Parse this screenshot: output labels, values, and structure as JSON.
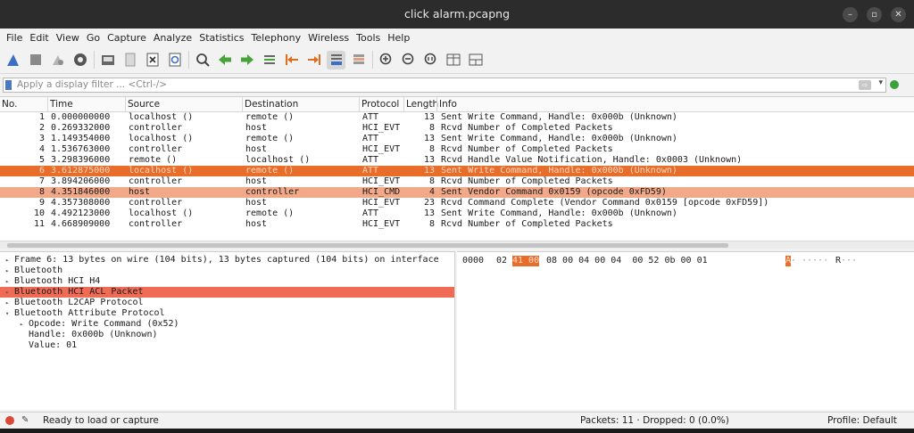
{
  "window": {
    "title": "click alarm.pcapng"
  },
  "menu": [
    "File",
    "Edit",
    "View",
    "Go",
    "Capture",
    "Analyze",
    "Statistics",
    "Telephony",
    "Wireless",
    "Tools",
    "Help"
  ],
  "filter": {
    "placeholder": "Apply a display filter ... <Ctrl-/>"
  },
  "columns": {
    "no": "No.",
    "time": "Time",
    "source": "Source",
    "destination": "Destination",
    "protocol": "Protocol",
    "length": "Length",
    "info": "Info"
  },
  "packets": [
    {
      "no": "1",
      "time": "0.000000000",
      "source": "localhost ()",
      "destination": "remote ()",
      "protocol": "ATT",
      "length": "13",
      "info": "Sent Write Command, Handle: 0x000b (Unknown)"
    },
    {
      "no": "2",
      "time": "0.269332000",
      "source": "controller",
      "destination": "host",
      "protocol": "HCI_EVT",
      "length": "8",
      "info": "Rcvd Number of Completed Packets"
    },
    {
      "no": "3",
      "time": "1.149354000",
      "source": "localhost ()",
      "destination": "remote ()",
      "protocol": "ATT",
      "length": "13",
      "info": "Sent Write Command, Handle: 0x000b (Unknown)"
    },
    {
      "no": "4",
      "time": "1.536763000",
      "source": "controller",
      "destination": "host",
      "protocol": "HCI_EVT",
      "length": "8",
      "info": "Rcvd Number of Completed Packets"
    },
    {
      "no": "5",
      "time": "3.298396000",
      "source": "remote ()",
      "destination": "localhost ()",
      "protocol": "ATT",
      "length": "13",
      "info": "Rcvd Handle Value Notification, Handle: 0x0003 (Unknown)"
    },
    {
      "no": "6",
      "time": "3.612875000",
      "source": "localhost ()",
      "destination": "remote ()",
      "protocol": "ATT",
      "length": "13",
      "info": "Sent Write Command, Handle: 0x000b (Unknown)"
    },
    {
      "no": "7",
      "time": "3.894206000",
      "source": "controller",
      "destination": "host",
      "protocol": "HCI_EVT",
      "length": "8",
      "info": "Rcvd Number of Completed Packets"
    },
    {
      "no": "8",
      "time": "4.351846000",
      "source": "host",
      "destination": "controller",
      "protocol": "HCI_CMD",
      "length": "4",
      "info": "Sent Vendor Command 0x0159 (opcode 0xFD59)"
    },
    {
      "no": "9",
      "time": "4.357308000",
      "source": "controller",
      "destination": "host",
      "protocol": "HCI_EVT",
      "length": "23",
      "info": "Rcvd Command Complete (Vendor Command 0x0159 [opcode 0xFD59])"
    },
    {
      "no": "10",
      "time": "4.492123000",
      "source": "localhost ()",
      "destination": "remote ()",
      "protocol": "ATT",
      "length": "13",
      "info": "Sent Write Command, Handle: 0x000b (Unknown)"
    },
    {
      "no": "11",
      "time": "4.668909000",
      "source": "controller",
      "destination": "host",
      "protocol": "HCI_EVT",
      "length": "8",
      "info": "Rcvd Number of Completed Packets"
    }
  ],
  "selected_packet": "6",
  "details": [
    {
      "text": "Frame 6: 13 bytes on wire (104 bits), 13 bytes captured (104 bits) on interface",
      "tri": "▸"
    },
    {
      "text": "Bluetooth",
      "tri": "▸"
    },
    {
      "text": "Bluetooth HCI H4",
      "tri": "▸"
    },
    {
      "text": "Bluetooth HCI ACL Packet",
      "tri": "▸"
    },
    {
      "text": "Bluetooth L2CAP Protocol",
      "tri": "▸"
    },
    {
      "text": "Bluetooth Attribute Protocol",
      "tri": "▾"
    },
    {
      "text": "Opcode: Write Command (0x52)",
      "tri": "▸"
    },
    {
      "text": "Handle: 0x000b (Unknown)",
      "tri": ""
    },
    {
      "text": "Value: 01",
      "tri": ""
    }
  ],
  "bytes": {
    "offset": "0000",
    "hex_a": "02",
    "hex_hl": "41 00",
    "hex_b": "08 00 04 00 04  00 52 0b 00 01",
    "ascii_hl": "A",
    "ascii_dots_1": "·",
    "ascii_dots_2": "·····",
    "ascii_r": "R",
    "ascii_dots_3": "···"
  },
  "status": {
    "left": "Ready to load or capture",
    "packets": "Packets: 11 · Dropped: 0 (0.0%)",
    "profile": "Profile: Default"
  },
  "colors": {
    "selected_row": "#e86c2a",
    "highlight_row": "#f2a98a",
    "detail_highlight": "#f06b55"
  }
}
